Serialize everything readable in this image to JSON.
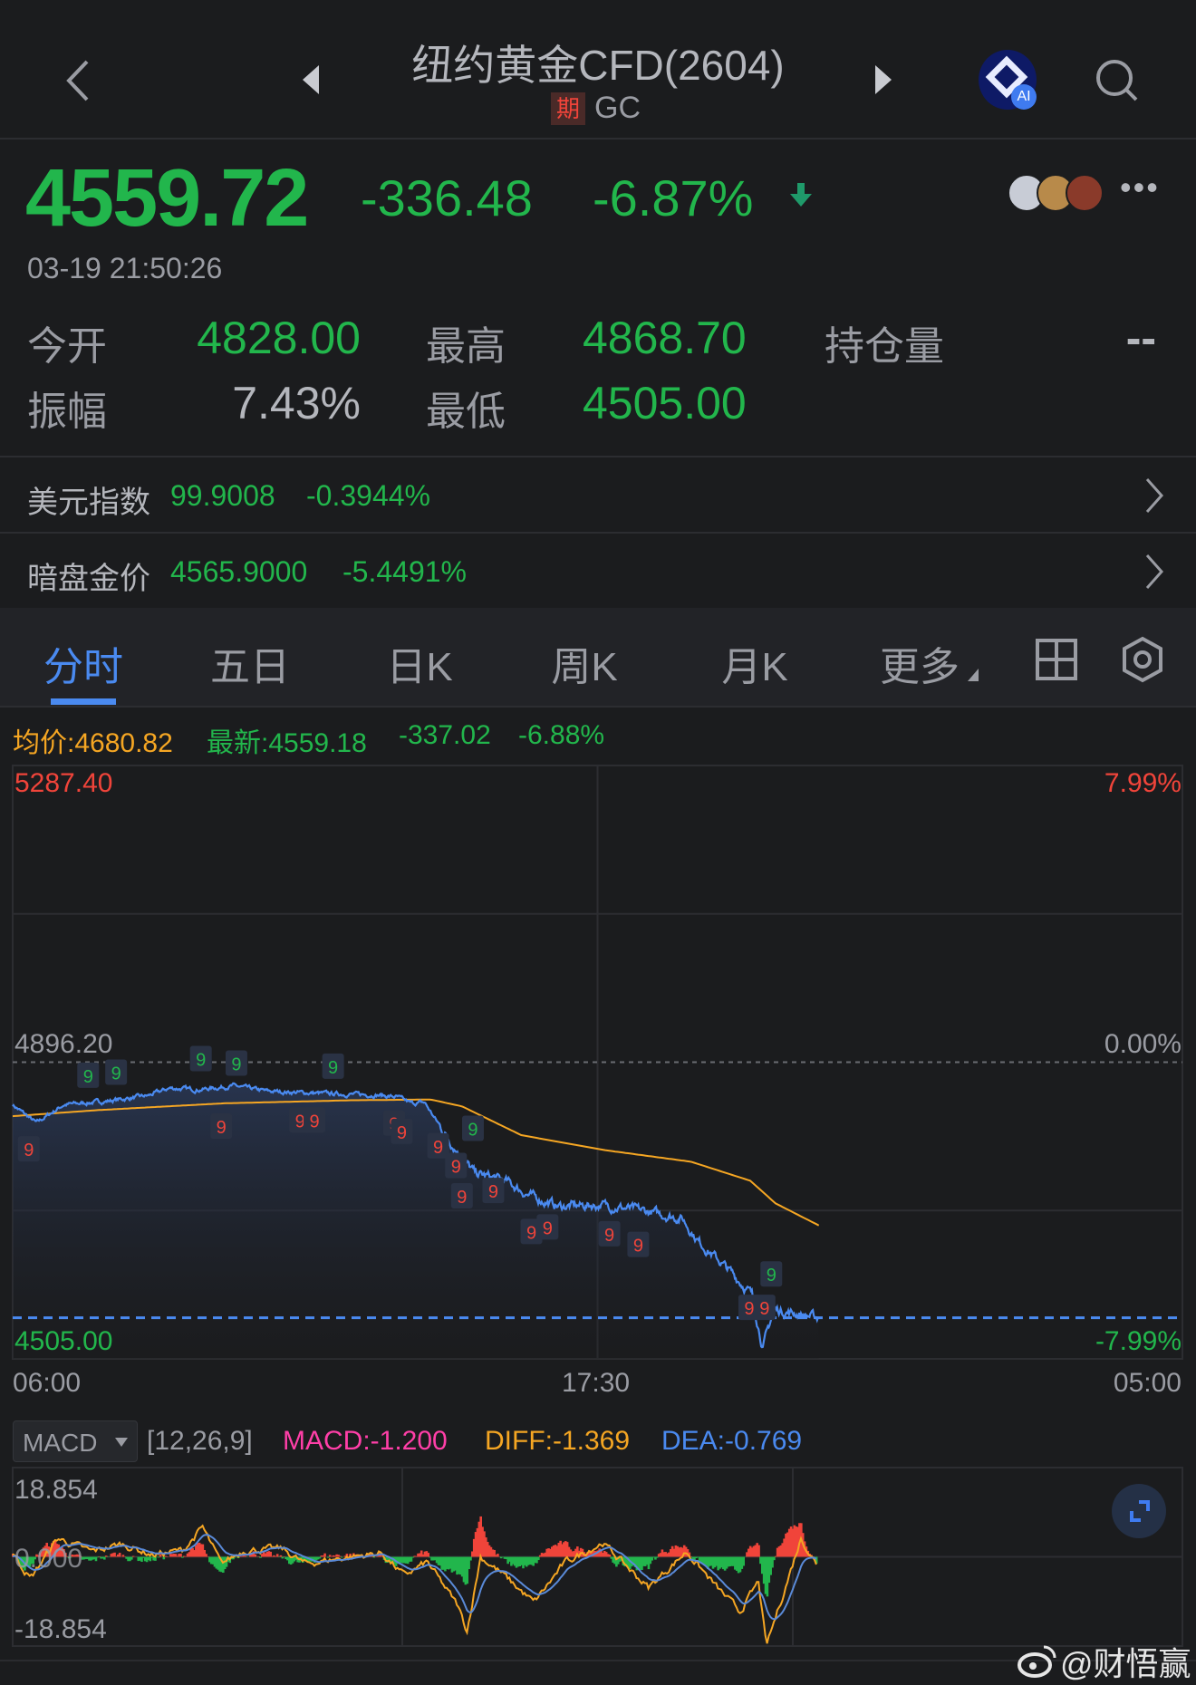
{
  "header": {
    "title": "纽约黄金CFD(2604)",
    "badge": "期",
    "code": "GC",
    "ai_badge": "AI"
  },
  "quote": {
    "price": "4559.72",
    "change": "-336.48",
    "change_pct": "-6.87%",
    "time": "03-19 21:50:26"
  },
  "stats": [
    {
      "label": "今开",
      "value": "4828.00"
    },
    {
      "label": "最高",
      "value": "4868.70"
    },
    {
      "label": "持仓量",
      "value": "--"
    },
    {
      "label": "振幅",
      "value": "7.43%"
    },
    {
      "label": "最低",
      "value": "4505.00"
    }
  ],
  "related": [
    {
      "label": "美元指数",
      "value": "99.9008",
      "pct": "-0.3944%"
    },
    {
      "label": "暗盘金价",
      "value": "4565.9000",
      "pct": "-5.4491%"
    }
  ],
  "tabs": [
    "分时",
    "五日",
    "日K",
    "周K",
    "月K",
    "更多"
  ],
  "legend": {
    "avg": "均价:4680.82",
    "latest": "最新:4559.18",
    "chg": "-337.02",
    "pct": "-6.88%"
  },
  "colors": {
    "green": "#22b64c",
    "red": "#f0443a",
    "blue": "#4a8af0",
    "orange": "#f5a623",
    "magenta": "#ff3fa8"
  },
  "chart_data": {
    "type": "line",
    "y_labels": {
      "top": "5287.40",
      "mid": "4896.20",
      "bottom": "4505.00",
      "top_pct": "7.99%",
      "mid_pct": "0.00%",
      "bottom_pct": "-7.99%"
    },
    "ylim": [
      4505.0,
      5287.4
    ],
    "prev_close": 4896.2,
    "latest": 4559.18,
    "x_labels": [
      "06:00",
      "17:30",
      "05:00"
    ],
    "x_range_minutes": [
      0,
      1380
    ],
    "price": [
      [
        0,
        4840
      ],
      [
        28,
        4816
      ],
      [
        60,
        4840
      ],
      [
        112,
        4845
      ],
      [
        160,
        4852
      ],
      [
        185,
        4862
      ],
      [
        220,
        4860
      ],
      [
        260,
        4865
      ],
      [
        300,
        4858
      ],
      [
        366,
        4855
      ],
      [
        430,
        4853
      ],
      [
        454,
        4850
      ],
      [
        470,
        4842
      ],
      [
        486,
        4843
      ],
      [
        505,
        4810
      ],
      [
        530,
        4770
      ],
      [
        545,
        4750
      ],
      [
        581,
        4740
      ],
      [
        610,
        4720
      ],
      [
        644,
        4706
      ],
      [
        695,
        4708
      ],
      [
        745,
        4700
      ],
      [
        790,
        4690
      ],
      [
        809,
        4660
      ],
      [
        847,
        4620
      ],
      [
        872,
        4590
      ],
      [
        885,
        4520
      ],
      [
        898,
        4570
      ],
      [
        923,
        4565
      ],
      [
        951,
        4559
      ]
    ],
    "avg": [
      [
        0,
        4825
      ],
      [
        100,
        4833
      ],
      [
        250,
        4842
      ],
      [
        400,
        4846
      ],
      [
        493,
        4847
      ],
      [
        530,
        4838
      ],
      [
        600,
        4800
      ],
      [
        700,
        4780
      ],
      [
        800,
        4765
      ],
      [
        870,
        4740
      ],
      [
        900,
        4710
      ],
      [
        951,
        4681
      ]
    ],
    "markers": [
      {
        "t": 89,
        "p": 4879,
        "c": "g"
      },
      {
        "t": 122,
        "p": 4883,
        "c": "g"
      },
      {
        "t": 222,
        "p": 4901,
        "c": "g"
      },
      {
        "t": 264,
        "p": 4895,
        "c": "g"
      },
      {
        "t": 378,
        "p": 4891,
        "c": "g"
      },
      {
        "t": 543,
        "p": 4809,
        "c": "g"
      },
      {
        "t": 895,
        "p": 4617,
        "c": "g"
      },
      {
        "t": 19,
        "p": 4782,
        "c": "r"
      },
      {
        "t": 246,
        "p": 4812,
        "c": "r"
      },
      {
        "t": 339,
        "p": 4820,
        "c": "r"
      },
      {
        "t": 356,
        "p": 4820,
        "c": "r"
      },
      {
        "t": 450,
        "p": 4816,
        "c": "r"
      },
      {
        "t": 459,
        "p": 4805,
        "c": "r"
      },
      {
        "t": 502,
        "p": 4786,
        "c": "r"
      },
      {
        "t": 523,
        "p": 4760,
        "c": "r"
      },
      {
        "t": 530,
        "p": 4720,
        "c": "r"
      },
      {
        "t": 567,
        "p": 4727,
        "c": "r"
      },
      {
        "t": 612,
        "p": 4673,
        "c": "r"
      },
      {
        "t": 631,
        "p": 4679,
        "c": "r"
      },
      {
        "t": 704,
        "p": 4670,
        "c": "r"
      },
      {
        "t": 738,
        "p": 4656,
        "c": "r"
      },
      {
        "t": 869,
        "p": 4573,
        "c": "r"
      },
      {
        "t": 887,
        "p": 4573,
        "c": "r"
      }
    ],
    "marker_label": "9"
  },
  "macd": {
    "selector": "MACD",
    "params": "[12,26,9]",
    "macd": "MACD:-1.200",
    "diff": "DIFF:-1.369",
    "dea": "DEA:-0.769",
    "top": "18.854",
    "zero": "0.000",
    "bottom": "-18.854",
    "ylim": [
      -18.854,
      18.854
    ],
    "diff_points": [
      [
        3,
        0
      ],
      [
        21,
        -4.6
      ],
      [
        53,
        3.9
      ],
      [
        93,
        1.1
      ],
      [
        129,
        2.7
      ],
      [
        165,
        0.4
      ],
      [
        201,
        1.4
      ],
      [
        224,
        6.2
      ],
      [
        246,
        -1.5
      ],
      [
        273,
        1.4
      ],
      [
        318,
        1.7
      ],
      [
        345,
        -1.5
      ],
      [
        390,
        -0.2
      ],
      [
        435,
        0.8
      ],
      [
        462,
        -4
      ],
      [
        489,
        -1.1
      ],
      [
        525,
        -10.3
      ],
      [
        536,
        -15.7
      ],
      [
        552,
        0
      ],
      [
        579,
        -3.8
      ],
      [
        615,
        -9.7
      ],
      [
        651,
        -1.3
      ],
      [
        696,
        3
      ],
      [
        750,
        -6.5
      ],
      [
        795,
        1.1
      ],
      [
        831,
        -6.5
      ],
      [
        858,
        -11.6
      ],
      [
        880,
        -5.3
      ],
      [
        889,
        -19
      ],
      [
        907,
        -9
      ],
      [
        930,
        3.9
      ],
      [
        948,
        -1.5
      ]
    ]
  },
  "watermark": "@财悟赢"
}
